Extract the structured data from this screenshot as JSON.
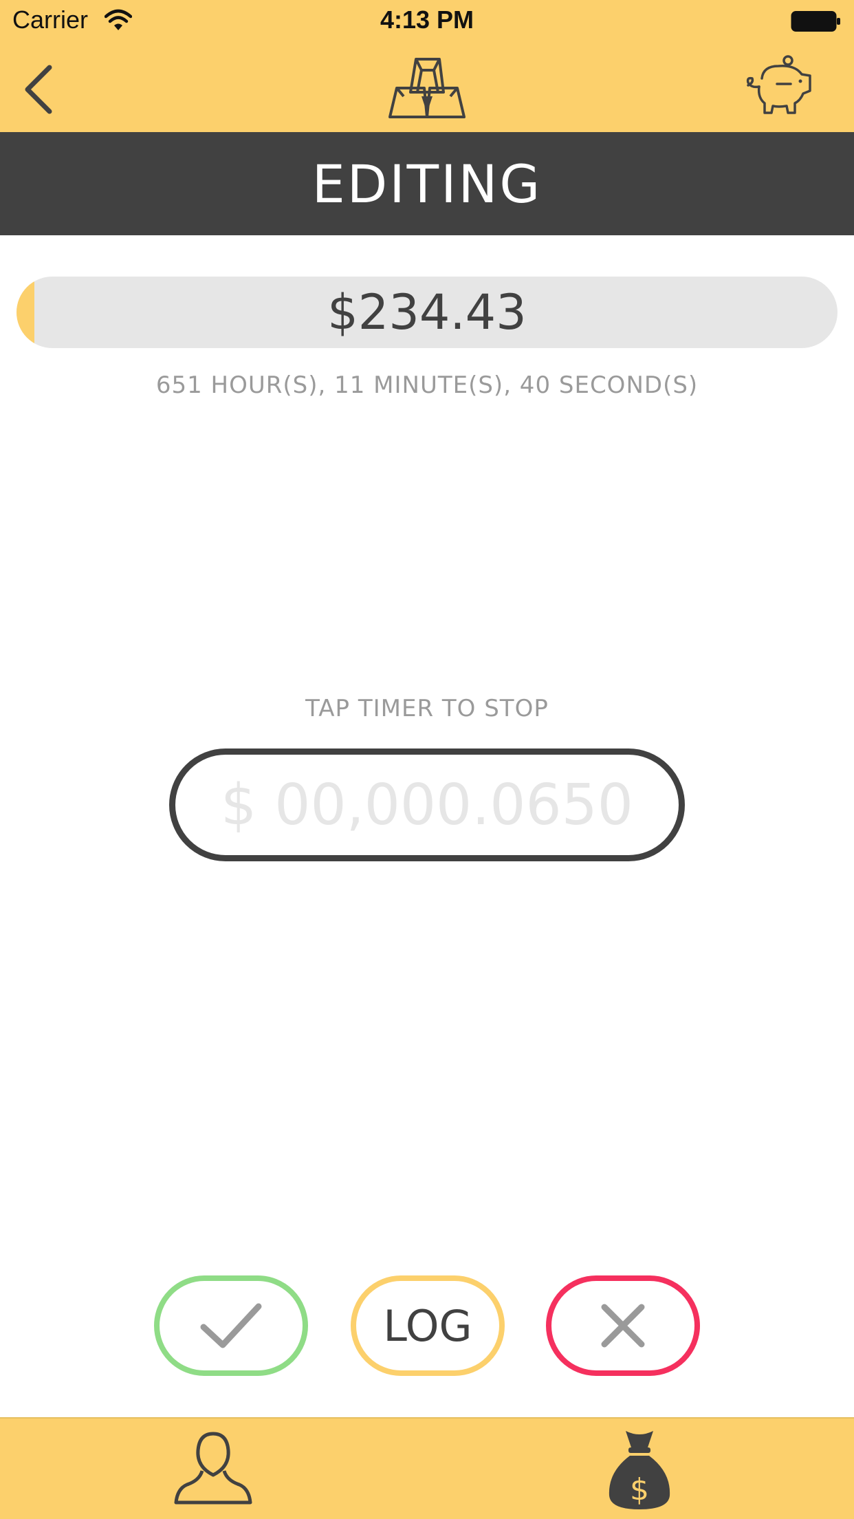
{
  "status_bar": {
    "carrier": "Carrier",
    "time": "4:13 PM",
    "wifi_icon": "wifi-icon",
    "battery_icon": "battery-icon"
  },
  "nav": {
    "back_icon": "chevron-left-icon",
    "logo_icon": "gold-bars-icon",
    "piggy_icon": "piggy-bank-icon"
  },
  "header": {
    "title": "EDITING"
  },
  "summary": {
    "amount": "$234.43",
    "progress_fraction": 0.022,
    "elapsed": "651 HOUR(S), 11 MINUTE(S), 40 SECOND(S)"
  },
  "timer": {
    "hint": "TAP TIMER TO STOP",
    "value": "$ 00,000.0650"
  },
  "actions": {
    "confirm_icon": "checkmark-icon",
    "log_label": "LOG",
    "cancel_icon": "close-icon"
  },
  "tab_bar": {
    "profile_icon": "user-icon",
    "money_icon": "money-bag-icon"
  },
  "colors": {
    "accent_yellow": "#fcd06c",
    "dark": "#414141",
    "confirm_green": "#8fdc86",
    "cancel_red": "#f5305e",
    "muted_text": "#9a9a9a",
    "track_gray": "#e6e6e6"
  }
}
